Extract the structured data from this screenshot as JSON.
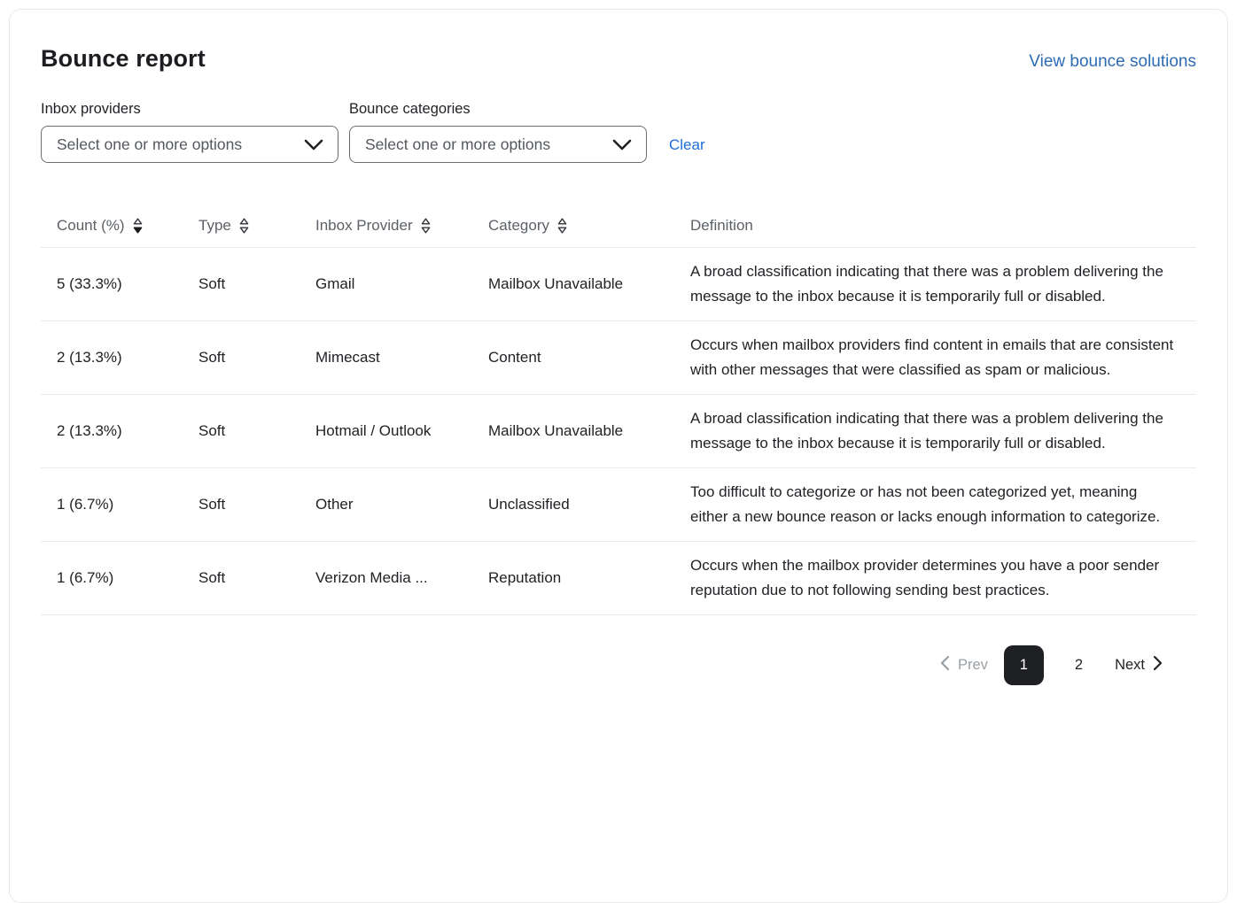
{
  "header": {
    "title": "Bounce report",
    "link_label": "View bounce solutions"
  },
  "filters": {
    "inbox_providers": {
      "label": "Inbox providers",
      "placeholder": "Select one or more options"
    },
    "bounce_categories": {
      "label": "Bounce categories",
      "placeholder": "Select one or more options"
    },
    "clear_label": "Clear"
  },
  "table": {
    "columns": [
      {
        "label": "Count (%)",
        "sortable": true,
        "sort": "desc"
      },
      {
        "label": "Type",
        "sortable": true,
        "sort": "none"
      },
      {
        "label": "Inbox Provider",
        "sortable": true,
        "sort": "none"
      },
      {
        "label": "Category",
        "sortable": true,
        "sort": "none"
      },
      {
        "label": "Definition",
        "sortable": false
      }
    ],
    "rows": [
      {
        "count": "5 (33.3%)",
        "type": "Soft",
        "provider": "Gmail",
        "category": "Mailbox Unavailable",
        "definition": "A broad classification indicating that there was a problem delivering the message to the inbox because it is temporarily full or disabled."
      },
      {
        "count": "2 (13.3%)",
        "type": "Soft",
        "provider": "Mimecast",
        "category": "Content",
        "definition": "Occurs when mailbox providers find content in emails that are consistent with other messages that were classified as spam or malicious."
      },
      {
        "count": "2 (13.3%)",
        "type": "Soft",
        "provider": "Hotmail / Outlook",
        "category": "Mailbox Unavailable",
        "definition": "A broad classification indicating that there was a problem delivering the message to the inbox because it is temporarily full or disabled."
      },
      {
        "count": "1 (6.7%)",
        "type": "Soft",
        "provider": "Other",
        "category": "Unclassified",
        "definition": "Too difficult to categorize or has not been categorized yet, meaning either a new bounce reason or lacks enough information to categorize."
      },
      {
        "count": "1 (6.7%)",
        "type": "Soft",
        "provider": "Verizon Media ...",
        "category": "Reputation",
        "definition": "Occurs when the mailbox provider determines you have a poor sender reputation due to not following sending best practices."
      }
    ]
  },
  "pagination": {
    "prev_label": "Prev",
    "next_label": "Next",
    "pages": [
      "1",
      "2"
    ],
    "current_page": "1"
  },
  "colors": {
    "link_blue": "#2d6bb4",
    "clear_blue": "#1e6fd9",
    "active_page_bg": "#1e2023",
    "header_gray": "#5c6167",
    "row_border": "#e8eaec"
  }
}
